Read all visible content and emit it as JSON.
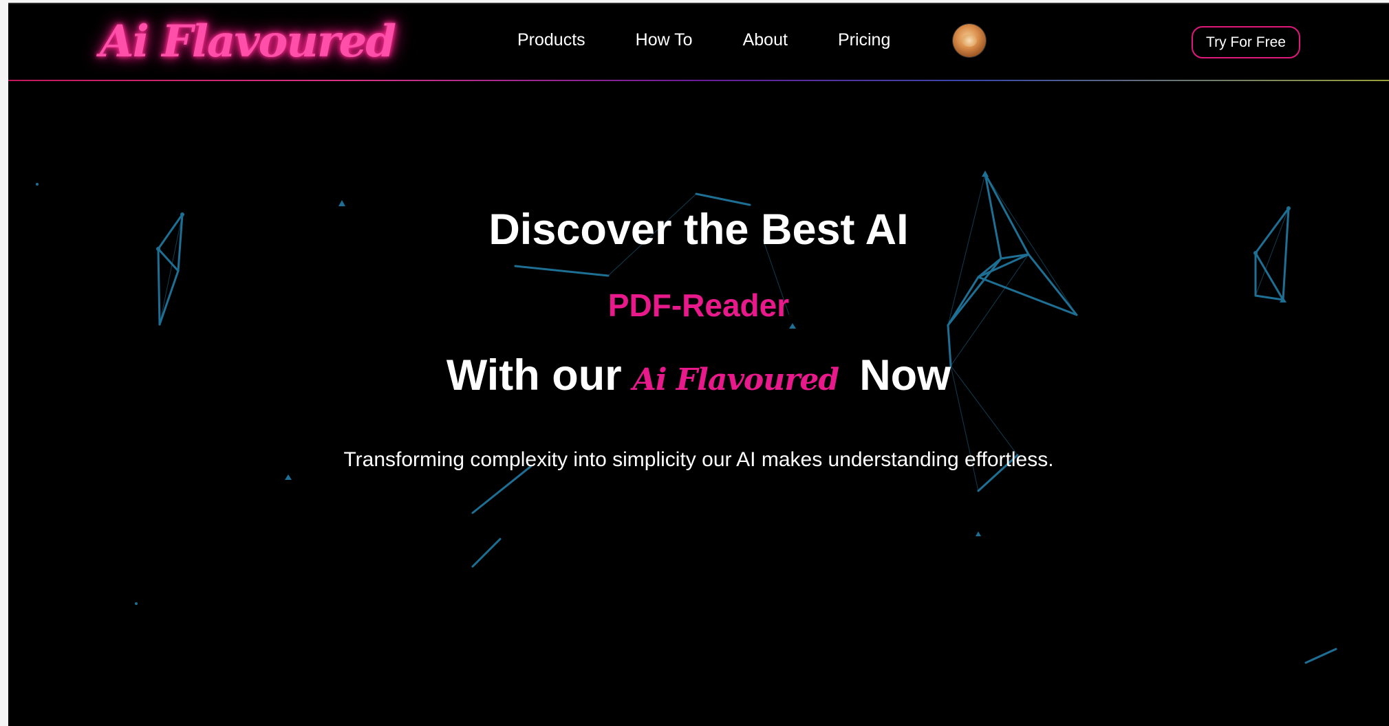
{
  "colors": {
    "background": "#000000",
    "accent": "#e8198a",
    "network_lines": "#1e6f94",
    "text": "#ffffff"
  },
  "header": {
    "logo_text": "Ai Flavoured",
    "nav": [
      {
        "label": "Products"
      },
      {
        "label": "How To"
      },
      {
        "label": "About"
      },
      {
        "label": "Pricing"
      }
    ],
    "avatar_icon": "cat-avatar",
    "cta_label": "Try For Free"
  },
  "hero": {
    "headline": "Discover the Best AI",
    "product": "PDF-Reader",
    "tagline_prefix": "With our",
    "tagline_brand": "Ai Flavoured",
    "tagline_suffix": "Now",
    "subtitle": "Transforming complexity into simplicity our AI makes understanding effortless."
  }
}
